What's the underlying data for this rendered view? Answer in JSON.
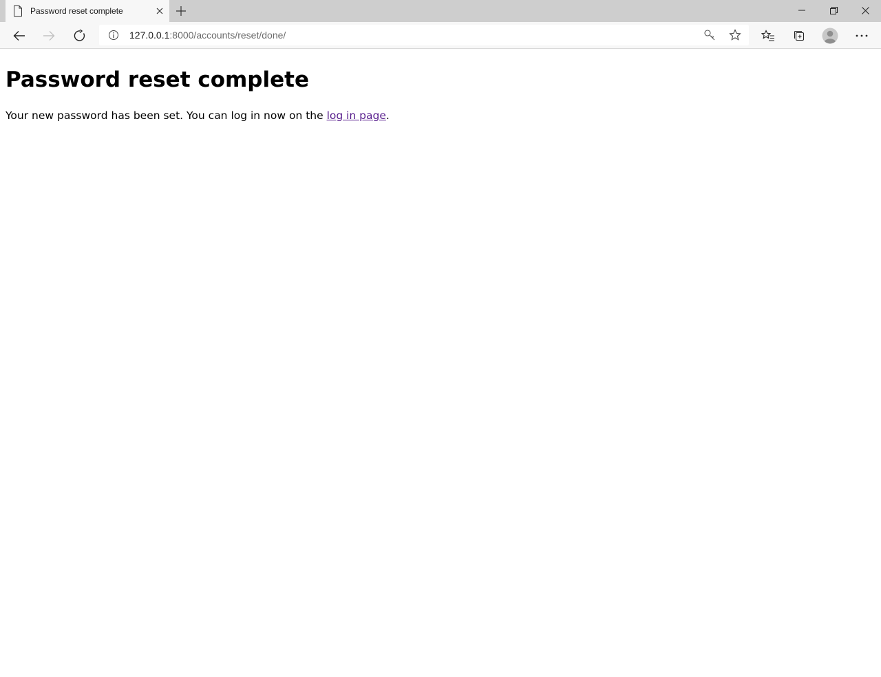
{
  "browser": {
    "tab": {
      "title": "Password reset complete",
      "icon": "page-icon",
      "close_icon": "close-icon"
    },
    "new_tab_icon": "plus-icon",
    "window_controls": [
      "minimize-icon",
      "restore-icon",
      "close-icon"
    ],
    "toolbar": {
      "back_icon": "arrow-left-icon",
      "forward_icon": "arrow-right-icon",
      "refresh_icon": "refresh-icon",
      "address": {
        "host": "127.0.0.1",
        "rest": ":8000/accounts/reset/done/"
      },
      "address_icons": [
        "key-icon",
        "star-icon"
      ],
      "right_icons": [
        "favorites-icon",
        "collections-icon",
        "profile-avatar",
        "more-icon"
      ]
    }
  },
  "page": {
    "title": "Password reset complete",
    "message_before": "Your new password has been set. You can log in now on the ",
    "login_link": "log in page",
    "message_after": ".",
    "link_color": "#551a8b"
  }
}
